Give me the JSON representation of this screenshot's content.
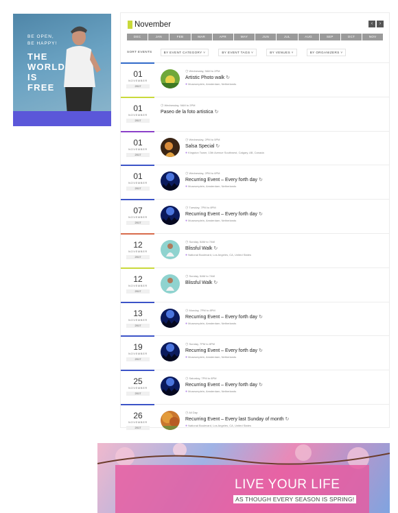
{
  "promo": {
    "line1": "BE OPEN,",
    "line2": "BE HAPPY!",
    "heading": [
      "THE",
      "WORLD",
      "IS",
      "FREE"
    ],
    "bar_color": "#5b57d9"
  },
  "calendar": {
    "month_title": "November",
    "prev_icon": "‹",
    "next_icon": "›",
    "months": [
      "DEC",
      "JAN",
      "FEB",
      "MAR",
      "APR",
      "MAY",
      "JUN",
      "JUL",
      "AUG",
      "SEP",
      "OCT",
      "NOV"
    ],
    "filters": {
      "sort_label": "SORT EVENTS",
      "category": "BY EVENT CATEGORY",
      "tags": "BY EVENT TAGS",
      "venues": "BY VENUES",
      "organizers": "BY ORGANIZERS"
    },
    "events": [
      {
        "day": "01",
        "month": "NOVEMBER",
        "year": "2017",
        "time": "Wednesday, 9AM to 2PM",
        "title": "Artistic Photo walk",
        "location": "Museumplein, Amsterdam, Netherlands",
        "accent": "#2f69c9",
        "thumb": "nature"
      },
      {
        "day": "01",
        "month": "NOVEMBER",
        "year": "2017",
        "time": "Wednesday, 9AM to 2PM",
        "title": "Paseo de la foto artistica",
        "location": "",
        "accent": "#c9d93a",
        "thumb": ""
      },
      {
        "day": "01",
        "month": "NOVEMBER",
        "year": "2017",
        "time": "Wednesday, 2PM to 5PM",
        "title": "Salsa Special",
        "location": "Kingston Tower, 13th Avenue Southwest, Calgary, AB, Canada",
        "accent": "#8a3fc8",
        "thumb": "salsa"
      },
      {
        "day": "01",
        "month": "NOVEMBER",
        "year": "2017",
        "time": "Wednesday, 2PM to 6PM",
        "title": "Recurring Event – Every forth day",
        "location": "Museumplein, Amsterdam, Netherlands",
        "accent": "#3b53c7",
        "thumb": "concert"
      },
      {
        "day": "07",
        "month": "NOVEMBER",
        "year": "2017",
        "time": "Tuesday, 7PM to 8PM",
        "title": "Recurring Event – Every forth day",
        "location": "Museumplein, Amsterdam, Netherlands",
        "accent": "#3b53c7",
        "thumb": "concert"
      },
      {
        "day": "12",
        "month": "NOVEMBER",
        "year": "2017",
        "time": "Sunday, 5AM to 7AM",
        "title": "Blissful Walk",
        "location": "National Boulevard, Los Angeles, CA, United States",
        "accent": "#d86a4a",
        "thumb": "yoga"
      },
      {
        "day": "12",
        "month": "NOVEMBER",
        "year": "2017",
        "time": "Sunday, 5AM to 7AM",
        "title": "Blissful Walk",
        "location": "",
        "accent": "#c9d93a",
        "thumb": "yoga"
      },
      {
        "day": "13",
        "month": "NOVEMBER",
        "year": "2017",
        "time": "Monday, 7PM to 8PM",
        "title": "Recurring Event – Every forth day",
        "location": "Museumplein, Amsterdam, Netherlands",
        "accent": "#3b53c7",
        "thumb": "concert"
      },
      {
        "day": "19",
        "month": "NOVEMBER",
        "year": "2017",
        "time": "Sunday, 7PM to 8PM",
        "title": "Recurring Event – Every forth day",
        "location": "Museumplein, Amsterdam, Netherlands",
        "accent": "#3b53c7",
        "thumb": "concert"
      },
      {
        "day": "25",
        "month": "NOVEMBER",
        "year": "2017",
        "time": "Saturday, 7PM to 8PM",
        "title": "Recurring Event – Every forth day",
        "location": "Museumplein, Amsterdam, Netherlands",
        "accent": "#3b53c7",
        "thumb": "concert"
      },
      {
        "day": "26",
        "month": "NOVEMBER",
        "year": "2017",
        "time": "All Day",
        "title": "Recurring Event – Every last Sunday of month",
        "location": "National Boulevard, Los Angeles, CA, United States",
        "accent": "#3b53c7",
        "thumb": "autumn"
      }
    ]
  },
  "banner": {
    "headline": "LIVE YOUR LIFE",
    "subline": "AS THOUGH EVERY SEASON IS SPRING!"
  }
}
